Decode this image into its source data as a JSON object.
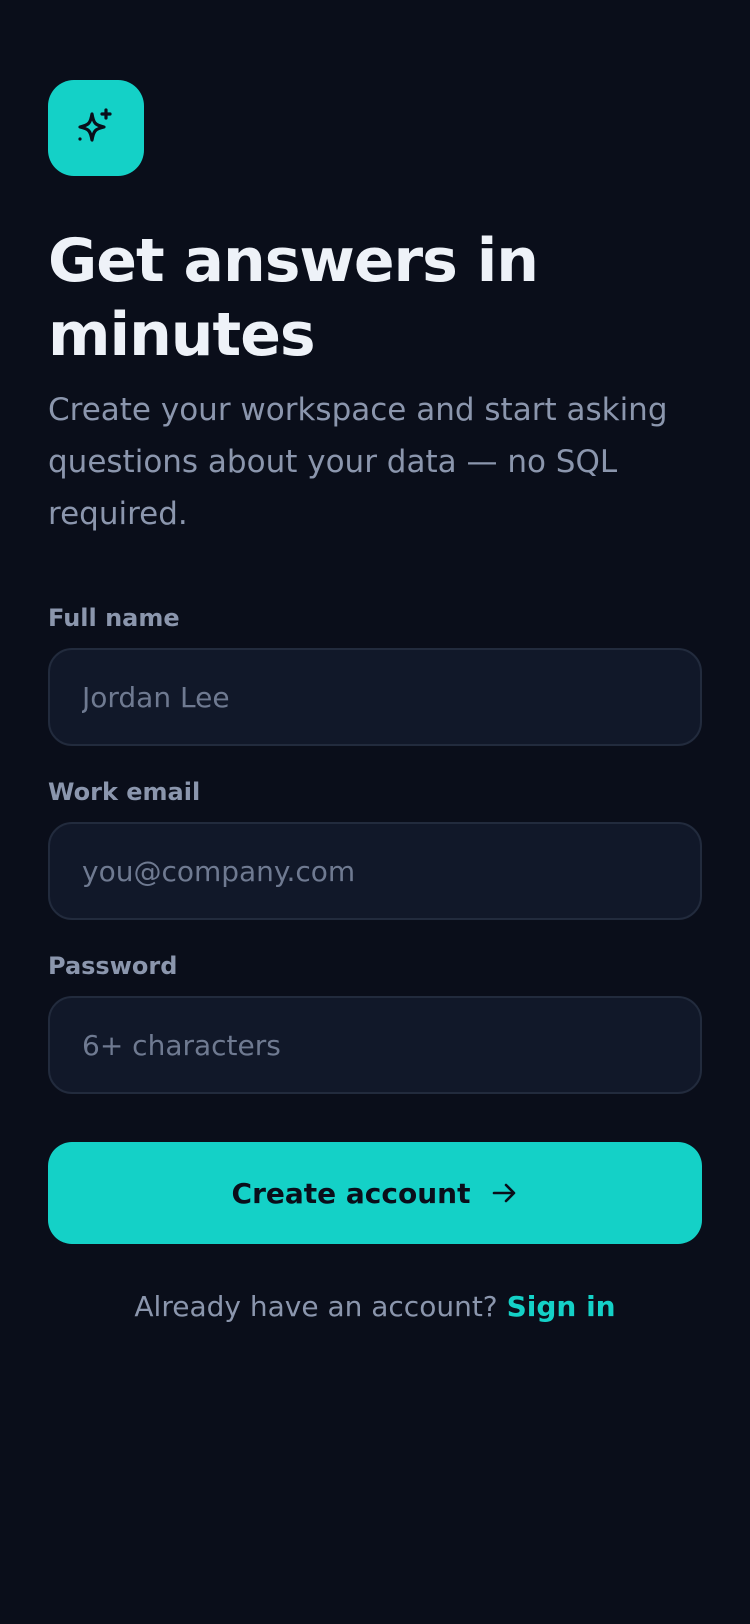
{
  "brand": {
    "logo_icon": "sparkle-icon",
    "accent_color": "#14d1c7",
    "background_color": "#0a0e1a"
  },
  "hero": {
    "title": "Get answers in minutes",
    "subtitle": "Create your workspace and start asking questions about your data — no SQL required."
  },
  "form": {
    "full_name": {
      "label": "Full name",
      "placeholder": "Jordan Lee",
      "value": ""
    },
    "work_email": {
      "label": "Work email",
      "placeholder": "you@company.com",
      "value": ""
    },
    "password": {
      "label": "Password",
      "placeholder": "6+ characters",
      "value": ""
    },
    "submit": {
      "label": "Create account",
      "icon": "arrow-right-icon"
    }
  },
  "footer": {
    "prompt": "Already have an account?",
    "link_label": "Sign in"
  }
}
